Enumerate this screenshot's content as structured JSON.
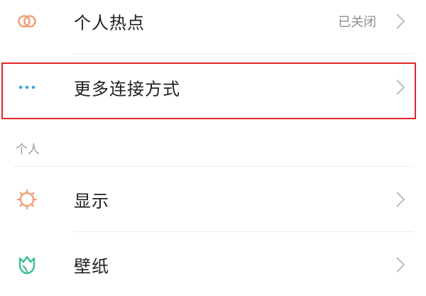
{
  "settings": {
    "rows": [
      {
        "label": "个人热点",
        "value": "已关闭",
        "icon": "hotspot-icon",
        "icon_color": "#f0a178"
      },
      {
        "label": "更多连接方式",
        "value": "",
        "icon": "more-dots-icon",
        "icon_color": "#3aa6d8"
      },
      {
        "label": "显示",
        "value": "",
        "icon": "sun-icon",
        "icon_color": "#f0a178"
      },
      {
        "label": "壁纸",
        "value": "",
        "icon": "tulip-icon",
        "icon_color": "#3dbf9a"
      }
    ],
    "section_header": "个人"
  },
  "colors": {
    "highlight_border": "#e0262b",
    "chevron": "#bdbdbd"
  }
}
